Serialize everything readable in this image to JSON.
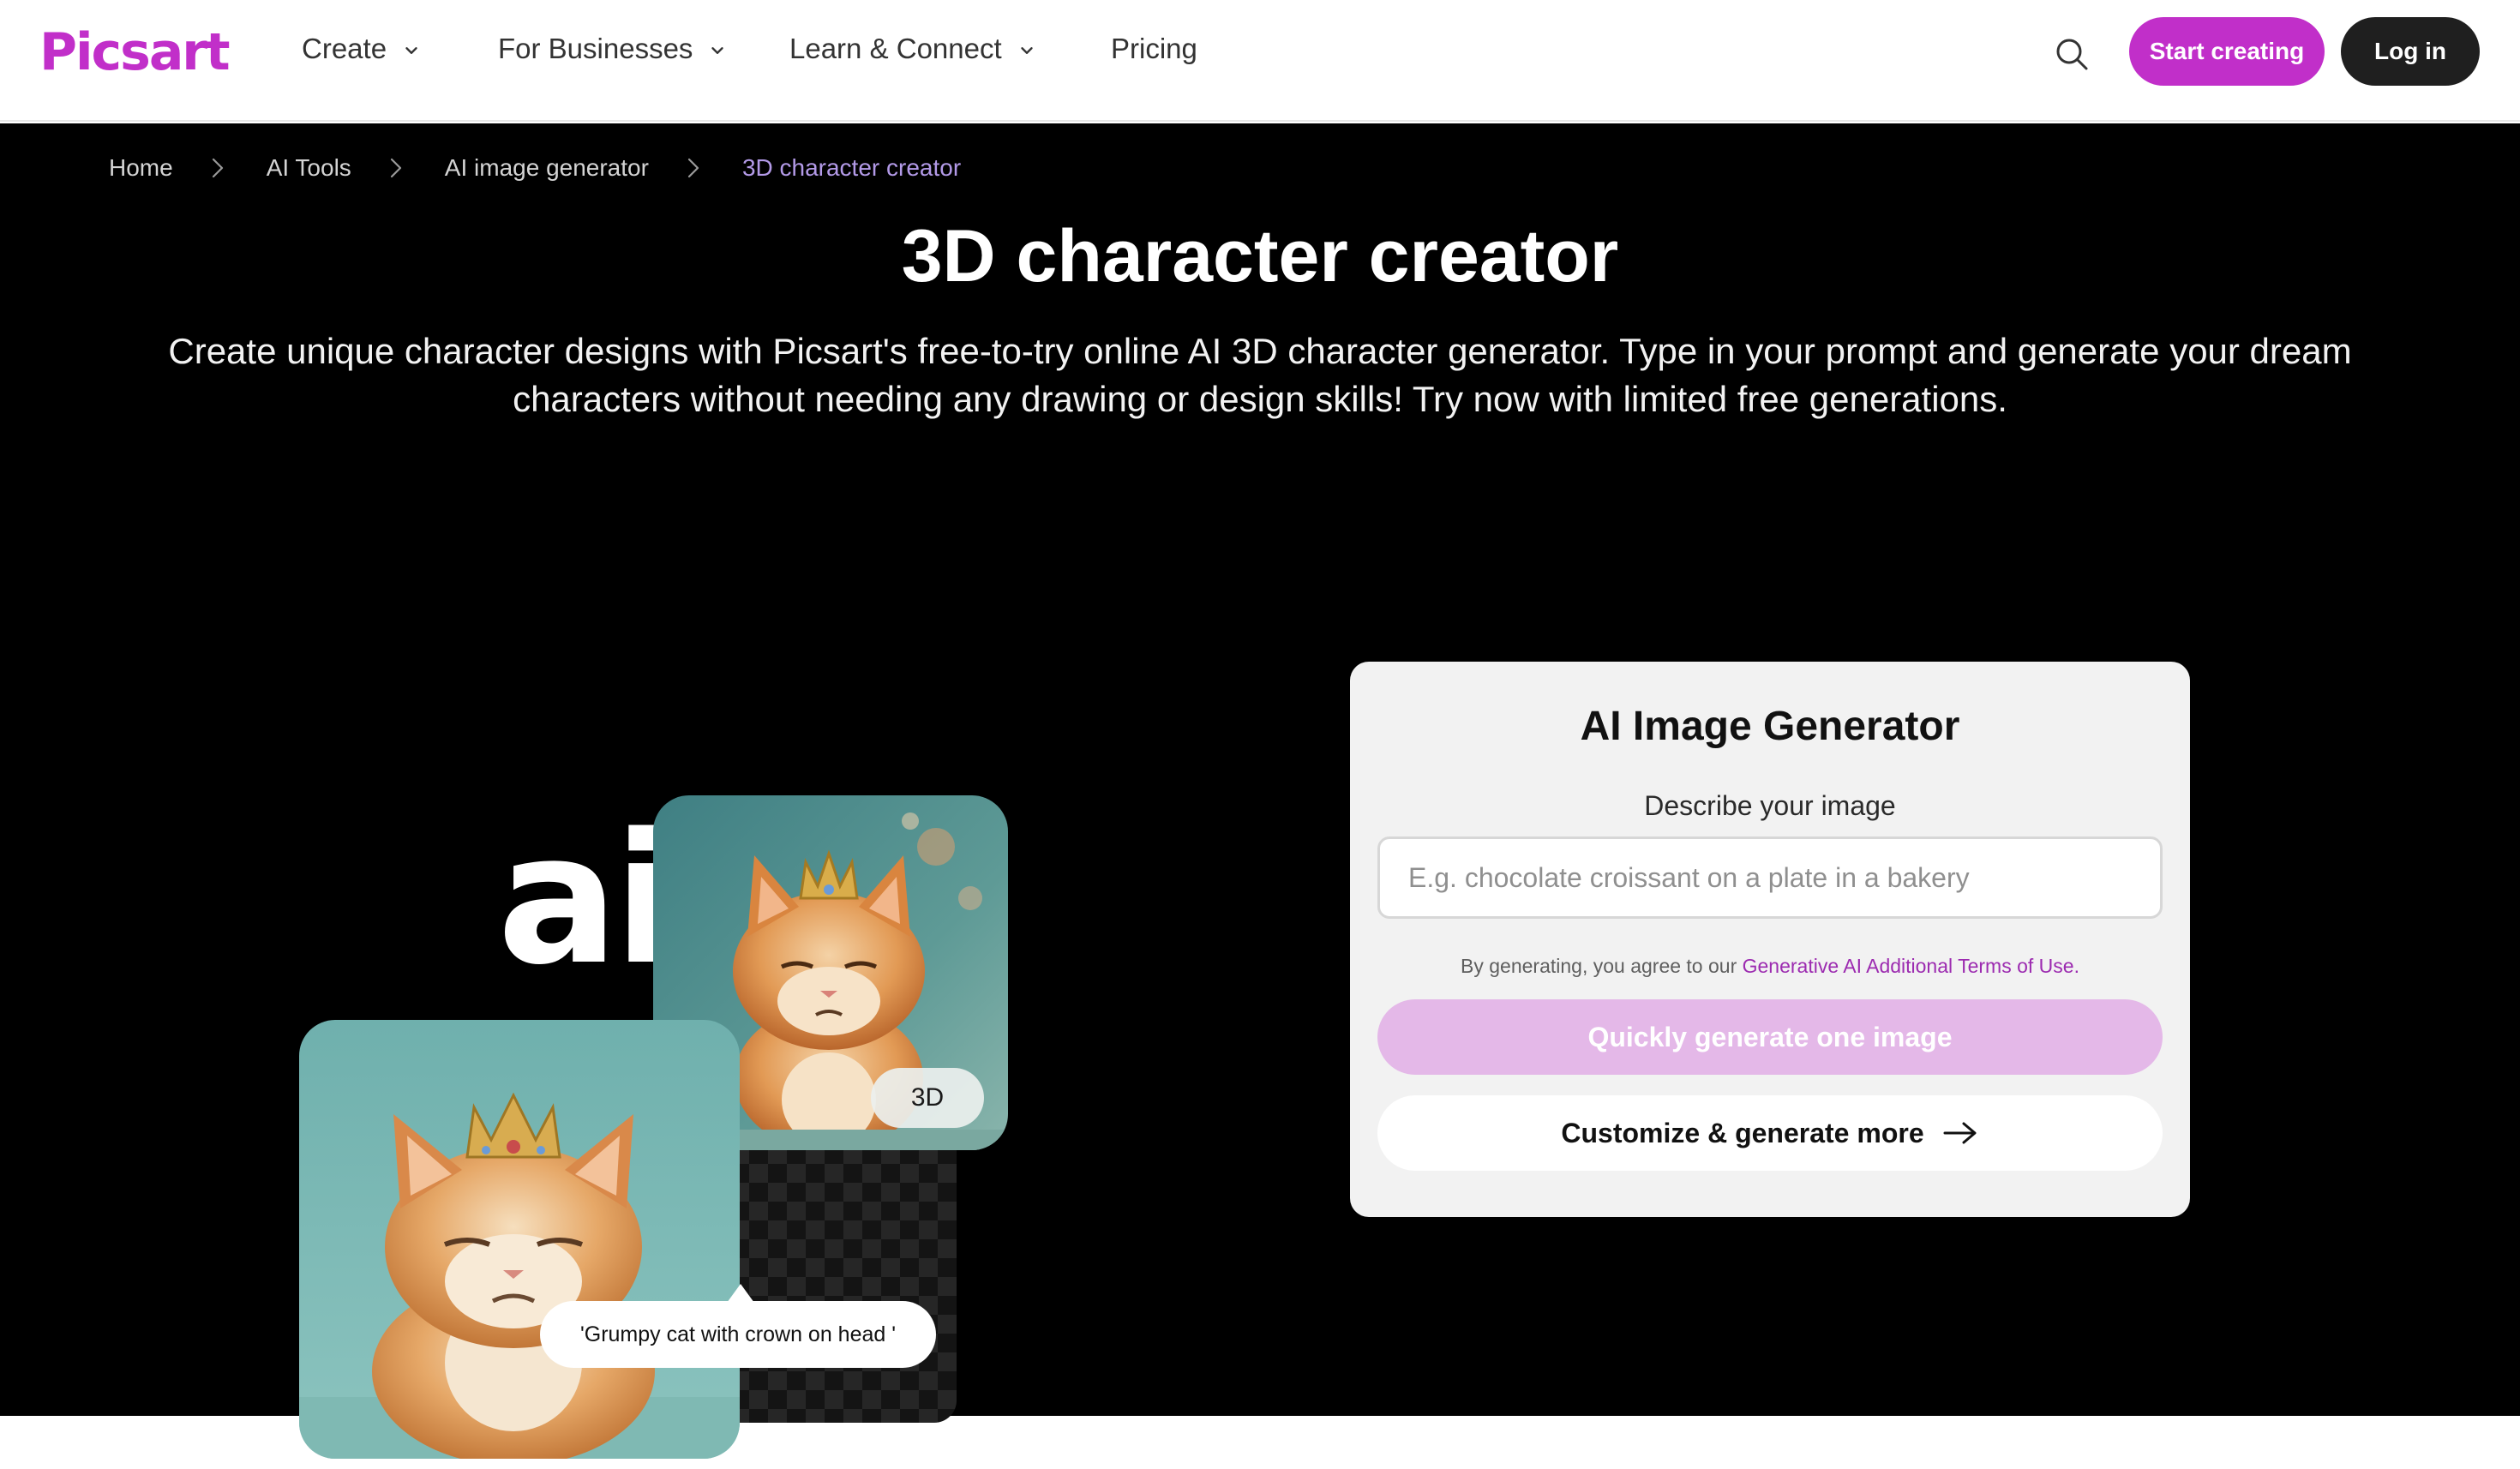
{
  "brand": {
    "logo_text": "Picsart",
    "primary_color": "#c12fc9",
    "disabled_color": "#e4b8e8",
    "breadcrumb_active_color": "#b39ae8"
  },
  "nav": {
    "items": [
      {
        "label": "Create",
        "icon": "chevron-down-icon"
      },
      {
        "label": "For Businesses",
        "icon": "chevron-down-icon"
      },
      {
        "label": "Learn & Connect",
        "icon": "chevron-down-icon"
      },
      {
        "label": "Pricing"
      }
    ],
    "search_icon": "search-icon",
    "start_label": "Start creating",
    "login_label": "Log in"
  },
  "breadcrumb": [
    "Home",
    "AI Tools",
    "AI image generator",
    "3D character creator"
  ],
  "hero": {
    "title": "3D character creator",
    "description": "Create unique character designs with Picsart's free-to-try online AI 3D character generator. Type in your prompt and generate your dream characters without needing any drawing or design skills! Try now with limited free generations."
  },
  "illustration": {
    "ai_mark": "ai",
    "badge": "3D",
    "prompt": "'Grumpy cat with crown on head '"
  },
  "generator": {
    "title": "AI Image Generator",
    "label": "Describe your image",
    "input_value": "",
    "input_placeholder": "E.g. chocolate croissant on a plate in a bakery",
    "terms_prefix": "By generating, you agree to our",
    "terms_link": "Generative AI Additional Terms of Use.",
    "quick_label": "Quickly generate one image",
    "custom_label": "Customize & generate more",
    "custom_icon": "arrow-right-icon"
  }
}
